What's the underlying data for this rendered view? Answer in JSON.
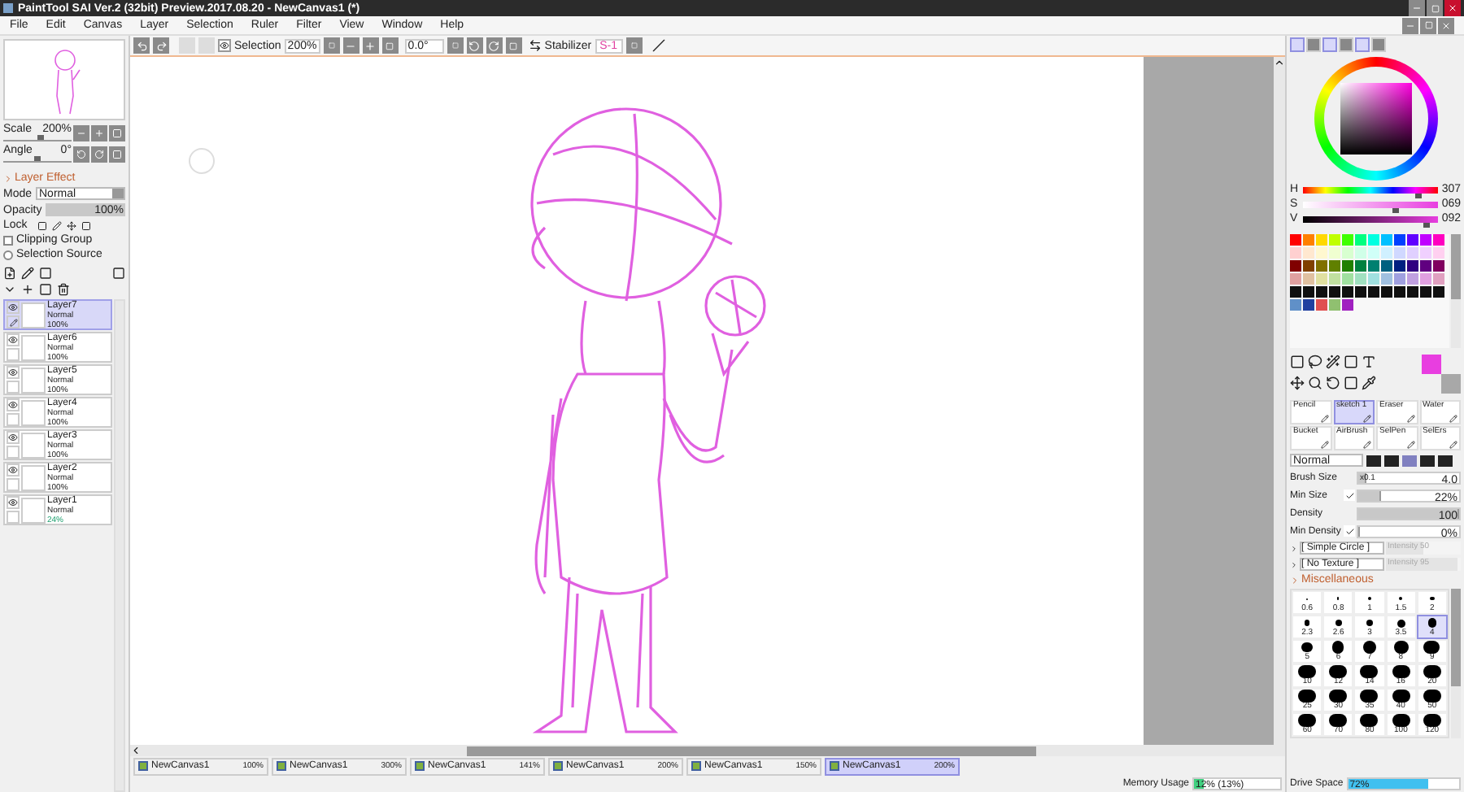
{
  "window": {
    "title": "PaintTool SAI Ver.2 (32bit) Preview.2017.08.20 - NewCanvas1 (*)"
  },
  "menu": [
    "File",
    "Edit",
    "Canvas",
    "Layer",
    "Selection",
    "Ruler",
    "Filter",
    "View",
    "Window",
    "Help"
  ],
  "toolbar": {
    "selection_label": "Selection",
    "selection_visible": true,
    "zoom": "200%",
    "angle": "0.0°",
    "stabilizer_label": "Stabilizer",
    "stabilizer": "S-1"
  },
  "navigator": {
    "scale": {
      "label": "Scale",
      "value": "200%",
      "level": 0.55
    },
    "angle": {
      "label": "Angle",
      "value": "0°",
      "level": 0.5
    }
  },
  "layer_effect": {
    "title": "Layer Effect",
    "mode_label": "Mode",
    "mode": "Normal",
    "opacity": {
      "label": "Opacity",
      "value": "100%",
      "level": 1
    },
    "lock_label": "Lock",
    "clipping_group": {
      "label": "Clipping Group",
      "checked": false
    },
    "selection_source": {
      "label": "Selection Source",
      "checked": false
    }
  },
  "layers": [
    {
      "name": "Layer7",
      "mode": "Normal",
      "opacity": "100%",
      "selected": true,
      "visible": true,
      "editing": true
    },
    {
      "name": "Layer6",
      "mode": "Normal",
      "opacity": "100%",
      "selected": false,
      "visible": true,
      "editing": false
    },
    {
      "name": "Layer5",
      "mode": "Normal",
      "opacity": "100%",
      "selected": false,
      "visible": true,
      "editing": false
    },
    {
      "name": "Layer4",
      "mode": "Normal",
      "opacity": "100%",
      "selected": false,
      "visible": true,
      "editing": false
    },
    {
      "name": "Layer3",
      "mode": "Normal",
      "opacity": "100%",
      "selected": false,
      "visible": true,
      "editing": false
    },
    {
      "name": "Layer2",
      "mode": "Normal",
      "opacity": "100%",
      "selected": false,
      "visible": true,
      "editing": false
    },
    {
      "name": "Layer1",
      "mode": "Normal",
      "opacity": "24%",
      "selected": false,
      "visible": true,
      "editing": false
    }
  ],
  "color": {
    "hsv": [
      {
        "label": "H",
        "value": "307",
        "level": 0.855
      },
      {
        "label": "S",
        "value": "069",
        "level": 0.69
      },
      {
        "label": "V",
        "value": "092",
        "level": 0.92
      }
    ],
    "foreground": {
      "color": "#e83ee0"
    },
    "background": {
      "color": "#a8a8a8"
    }
  },
  "palette": [
    [
      {
        "color": "#ff0000"
      },
      {
        "color": "#ff8000"
      },
      {
        "color": "#ffd800"
      },
      {
        "color": "#c0ff00"
      },
      {
        "color": "#40ff00"
      },
      {
        "color": "#00ff80"
      },
      {
        "color": "#00ffe0"
      },
      {
        "color": "#00c0ff"
      },
      {
        "color": "#0040ff"
      },
      {
        "color": "#6000ff"
      },
      {
        "color": "#c000ff"
      },
      {
        "color": "#ff00c0"
      }
    ],
    [
      {
        "color": "#ffd0d0"
      },
      {
        "color": "#ffe8d0"
      },
      {
        "color": "#fff8d0"
      },
      {
        "color": "#f0ffd0"
      },
      {
        "color": "#d8ffd0"
      },
      {
        "color": "#d0ffe8"
      },
      {
        "color": "#d0fff8"
      },
      {
        "color": "#d0f0ff"
      },
      {
        "color": "#d0d8ff"
      },
      {
        "color": "#e0d0ff"
      },
      {
        "color": "#f0d0ff"
      },
      {
        "color": "#ffd0f0"
      }
    ],
    [
      {
        "color": "#800000"
      },
      {
        "color": "#804000"
      },
      {
        "color": "#807000"
      },
      {
        "color": "#608000"
      },
      {
        "color": "#208000"
      },
      {
        "color": "#008040"
      },
      {
        "color": "#008070"
      },
      {
        "color": "#006080"
      },
      {
        "color": "#002080"
      },
      {
        "color": "#300080"
      },
      {
        "color": "#600080"
      },
      {
        "color": "#800060"
      }
    ],
    [
      {
        "color": "#e0a0a0"
      },
      {
        "color": "#e0c0a0"
      },
      {
        "color": "#e0e0a0"
      },
      {
        "color": "#c0e0a0"
      },
      {
        "color": "#a0e0a0"
      },
      {
        "color": "#a0e0c0"
      },
      {
        "color": "#a0e0e0"
      },
      {
        "color": "#a0c0e0"
      },
      {
        "color": "#a0a0e0"
      },
      {
        "color": "#c0a0e0"
      },
      {
        "color": "#e0a0e0"
      },
      {
        "color": "#e0a0c0"
      }
    ],
    [
      {
        "color": "#101010"
      },
      {
        "color": "#101010"
      },
      {
        "color": "#101010"
      },
      {
        "color": "#101010"
      },
      {
        "color": "#101010"
      },
      {
        "color": "#101010"
      },
      {
        "color": "#101010"
      },
      {
        "color": "#101010"
      },
      {
        "color": "#101010"
      },
      {
        "color": "#101010"
      },
      {
        "color": "#101010"
      },
      {
        "color": "#101010"
      }
    ],
    [
      {
        "color": "#6090c8"
      },
      {
        "color": "#2040a0"
      },
      {
        "color": "#e05050"
      },
      {
        "color": "#90c070"
      },
      {
        "color": "#a020c0"
      }
    ]
  ],
  "brushes": [
    {
      "name": "Pencil",
      "selected": false
    },
    {
      "name": "sketch 1",
      "selected": true
    },
    {
      "name": "Eraser",
      "selected": false
    },
    {
      "name": "Water",
      "selected": false
    },
    {
      "name": "Bucket",
      "selected": false
    },
    {
      "name": "AirBrush",
      "selected": false
    },
    {
      "name": "SelPen",
      "selected": false
    },
    {
      "name": "SelErs",
      "selected": false
    }
  ],
  "brush_settings": {
    "blend_mode": "Normal",
    "params": [
      {
        "kind": "size",
        "label": "Brush Size",
        "multiplier": "x0.1",
        "value": "4.0",
        "level": 0.08
      },
      {
        "kind": "check",
        "label": "Min Size",
        "checked": true,
        "value": "22%",
        "level": 0.22
      },
      {
        "kind": "plain",
        "label": "Density",
        "value": "100",
        "level": 1
      },
      {
        "kind": "check",
        "label": "Min Density",
        "checked": true,
        "value": "0%",
        "level": 0
      }
    ],
    "shape": {
      "name": "[ Simple Circle ]",
      "intensity": "Intensity 50",
      "level": 0.5
    },
    "texture": {
      "name": "[ No Texture ]",
      "intensity": "Intensity 95",
      "level": 0.95
    }
  },
  "miscellaneous": {
    "title": "Miscellaneous"
  },
  "sizes": [
    {
      "label": "0.6",
      "selected": false
    },
    {
      "label": "0.8",
      "selected": false
    },
    {
      "label": "1",
      "selected": false
    },
    {
      "label": "1.5",
      "selected": false
    },
    {
      "label": "2",
      "selected": false
    },
    {
      "label": "2.3",
      "selected": false
    },
    {
      "label": "2.6",
      "selected": false
    },
    {
      "label": "3",
      "selected": false
    },
    {
      "label": "3.5",
      "selected": false
    },
    {
      "label": "4",
      "selected": true
    },
    {
      "label": "5",
      "selected": false
    },
    {
      "label": "6",
      "selected": false
    },
    {
      "label": "7",
      "selected": false
    },
    {
      "label": "8",
      "selected": false
    },
    {
      "label": "9",
      "selected": false
    },
    {
      "label": "10",
      "selected": false
    },
    {
      "label": "12",
      "selected": false
    },
    {
      "label": "14",
      "selected": false
    },
    {
      "label": "16",
      "selected": false
    },
    {
      "label": "20",
      "selected": false
    },
    {
      "label": "25",
      "selected": false
    },
    {
      "label": "30",
      "selected": false
    },
    {
      "label": "35",
      "selected": false
    },
    {
      "label": "40",
      "selected": false
    },
    {
      "label": "50",
      "selected": false
    },
    {
      "label": "60",
      "selected": false
    },
    {
      "label": "70",
      "selected": false
    },
    {
      "label": "80",
      "selected": false
    },
    {
      "label": "100",
      "selected": false
    },
    {
      "label": "120",
      "selected": false
    }
  ],
  "tabs": [
    {
      "name": "NewCanvas1",
      "zoom": "100%",
      "selected": false
    },
    {
      "name": "NewCanvas1",
      "zoom": "300%",
      "selected": false
    },
    {
      "name": "NewCanvas1",
      "zoom": "141%",
      "selected": false
    },
    {
      "name": "NewCanvas1",
      "zoom": "200%",
      "selected": false
    },
    {
      "name": "NewCanvas1",
      "zoom": "150%",
      "selected": false
    },
    {
      "name": "NewCanvas1",
      "zoom": "200%",
      "selected": true
    }
  ],
  "status_bar": {
    "memory": {
      "label": "Memory Usage",
      "value": "12% (13%)",
      "level": 0.12
    },
    "drive": {
      "label": "Drive Space",
      "value": "72%",
      "level": 0.72
    }
  }
}
